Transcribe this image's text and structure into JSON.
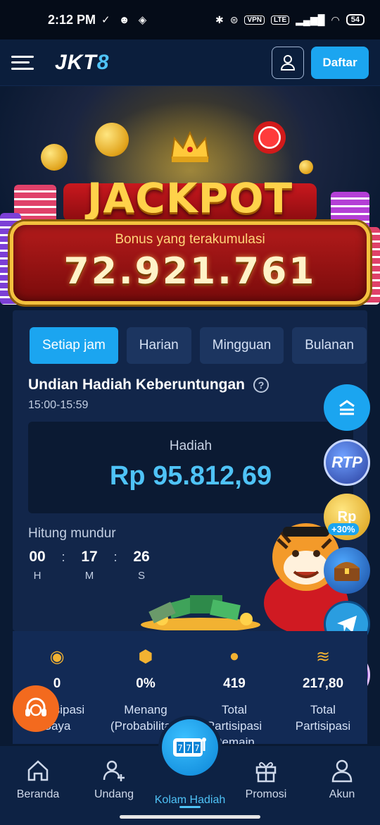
{
  "status_bar": {
    "time": "2:12 PM",
    "vpn": "VPN",
    "lte": "LTE",
    "battery": "54"
  },
  "header": {
    "logo_text": "JKT",
    "logo_num": "8",
    "register_label": "Daftar"
  },
  "jackpot": {
    "title": "JACKPOT",
    "subtitle": "Bonus yang terakumulasi",
    "amount": "72.921.761"
  },
  "tabs": [
    {
      "label": "Setiap jam",
      "active": true
    },
    {
      "label": "Harian",
      "active": false
    },
    {
      "label": "Mingguan",
      "active": false
    },
    {
      "label": "Bulanan",
      "active": false
    }
  ],
  "draw": {
    "title": "Undian Hadiah Keberuntungan",
    "time_range": "15:00-15:59",
    "prize_label": "Hadiah",
    "prize_amount": "Rp 95.812,69",
    "countdown_label": "Hitung mundur",
    "countdown": {
      "hours": "00",
      "minutes": "17",
      "seconds": "26",
      "h": "H",
      "m": "M",
      "s": "S"
    }
  },
  "floating": {
    "rtp_label": "RTP",
    "rp_label": "Rp",
    "bonus_label": "+30%"
  },
  "stats": [
    {
      "value": "0",
      "label": "Partisipasi Saya",
      "icon": "coin-icon"
    },
    {
      "value": "0%",
      "label": "Menang (Probabilitas)",
      "icon": "money-bag-icon"
    },
    {
      "value": "419",
      "label": "Total Partisipasi Pemain",
      "icon": "person-icon"
    },
    {
      "value": "217,80",
      "label": "Total Partisipasi",
      "icon": "coins-stack-icon"
    }
  ],
  "nav": [
    {
      "label": "Beranda",
      "icon": "home-icon"
    },
    {
      "label": "Undang",
      "icon": "add-user-icon"
    },
    {
      "label": "Kolam Hadiah",
      "icon": "slot-machine-icon",
      "active": true
    },
    {
      "label": "Promosi",
      "icon": "gift-icon"
    },
    {
      "label": "Akun",
      "icon": "account-icon"
    }
  ],
  "colors": {
    "accent": "#1ba5f0",
    "prize": "#4fc3f7",
    "gold": "#ffd24a",
    "support": "#f36a1e"
  }
}
